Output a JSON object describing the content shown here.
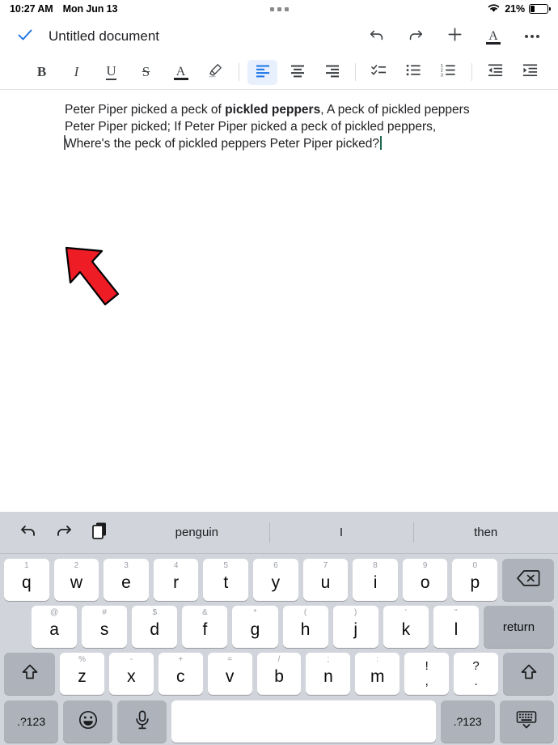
{
  "status_bar": {
    "time": "10:27 AM",
    "date": "Mon Jun 13",
    "battery_percent": "21%",
    "battery_level": 21,
    "wifi_icon": "wifi-icon",
    "handle_icon": "multitask-handle-icon"
  },
  "appbar": {
    "done_icon": "checkmark-icon",
    "title": "Untitled document",
    "undo_icon": "undo-icon",
    "redo_icon": "redo-icon",
    "add_icon": "plus-icon",
    "text_format_icon": "text-format-icon",
    "text_format_glyph": "A",
    "more_icon": "more-options-icon",
    "accent_color": "#1a73e8"
  },
  "format_toolbar": {
    "items": [
      {
        "name": "bold",
        "glyph": "B",
        "active": false
      },
      {
        "name": "italic",
        "glyph": "I",
        "active": false
      },
      {
        "name": "underline",
        "glyph": "U",
        "active": false
      },
      {
        "name": "strikethrough",
        "glyph": "S",
        "active": false
      },
      {
        "name": "text-color",
        "glyph": "A",
        "active": false
      },
      {
        "name": "highlight",
        "glyph": "",
        "active": false
      },
      {
        "name": "align-left",
        "glyph": "",
        "active": true
      },
      {
        "name": "align-center",
        "glyph": "",
        "active": false
      },
      {
        "name": "align-right",
        "glyph": "",
        "active": false
      },
      {
        "name": "checklist",
        "glyph": "",
        "active": false
      },
      {
        "name": "bulleted-list",
        "glyph": "",
        "active": false
      },
      {
        "name": "numbered-list",
        "glyph": "",
        "active": false
      },
      {
        "name": "decrease-indent",
        "glyph": "",
        "active": false
      },
      {
        "name": "increase-indent",
        "glyph": "",
        "active": false
      }
    ],
    "active_color": "#1a73e8",
    "active_bg": "#e8f0fe"
  },
  "document": {
    "line1_pre": "Peter Piper picked a peck of ",
    "line1_bold": "pickled peppers",
    "line1_post": ", A peck of pickled peppers",
    "line2": "Peter Piper picked; If Peter Piper picked a peck of pickled peppers,",
    "line3": "Where's the peck of pickled peppers Peter Piper picked?",
    "cursor_color": "#1d6b4f",
    "annotation": {
      "name": "red-arrow-annotation",
      "color": "#ee1c25"
    }
  },
  "keyboard": {
    "predictive": {
      "undo_icon": "undo-icon",
      "redo_icon": "redo-icon",
      "paste_icon": "paste-icon",
      "suggestions": [
        "penguin",
        "I",
        "then"
      ]
    },
    "row1": [
      {
        "sub": "1",
        "main": "q"
      },
      {
        "sub": "2",
        "main": "w"
      },
      {
        "sub": "3",
        "main": "e"
      },
      {
        "sub": "4",
        "main": "r"
      },
      {
        "sub": "5",
        "main": "t"
      },
      {
        "sub": "6",
        "main": "y"
      },
      {
        "sub": "7",
        "main": "u"
      },
      {
        "sub": "8",
        "main": "i"
      },
      {
        "sub": "9",
        "main": "o"
      },
      {
        "sub": "0",
        "main": "p"
      }
    ],
    "backspace_label": "backspace-icon",
    "row2": [
      {
        "sub": "@",
        "main": "a"
      },
      {
        "sub": "#",
        "main": "s"
      },
      {
        "sub": "$",
        "main": "d"
      },
      {
        "sub": "&",
        "main": "f"
      },
      {
        "sub": "*",
        "main": "g"
      },
      {
        "sub": "(",
        "main": "h"
      },
      {
        "sub": ")",
        "main": "j"
      },
      {
        "sub": "'",
        "main": "k"
      },
      {
        "sub": "\"",
        "main": "l"
      }
    ],
    "return_label": "return",
    "row3": [
      {
        "sub": "%",
        "main": "z"
      },
      {
        "sub": "-",
        "main": "x"
      },
      {
        "sub": "+",
        "main": "c"
      },
      {
        "sub": "=",
        "main": "v"
      },
      {
        "sub": "/",
        "main": "b"
      },
      {
        "sub": ";",
        "main": "n"
      },
      {
        "sub": ":",
        "main": "m"
      }
    ],
    "punct1": {
      "top": "!",
      "bottom": ","
    },
    "punct2": {
      "top": "?",
      "bottom": "."
    },
    "shift_left_icon": "shift-icon",
    "shift_right_icon": "shift-icon",
    "numeric_left_label": ".?123",
    "numeric_right_label": ".?123",
    "emoji_icon": "emoji-icon",
    "mic_icon": "microphone-icon",
    "space_label": "",
    "dismiss_icon": "hide-keyboard-icon",
    "key_bg": "#ffffff",
    "modifier_bg": "#aeb3bb",
    "board_bg": "#d1d5db"
  }
}
